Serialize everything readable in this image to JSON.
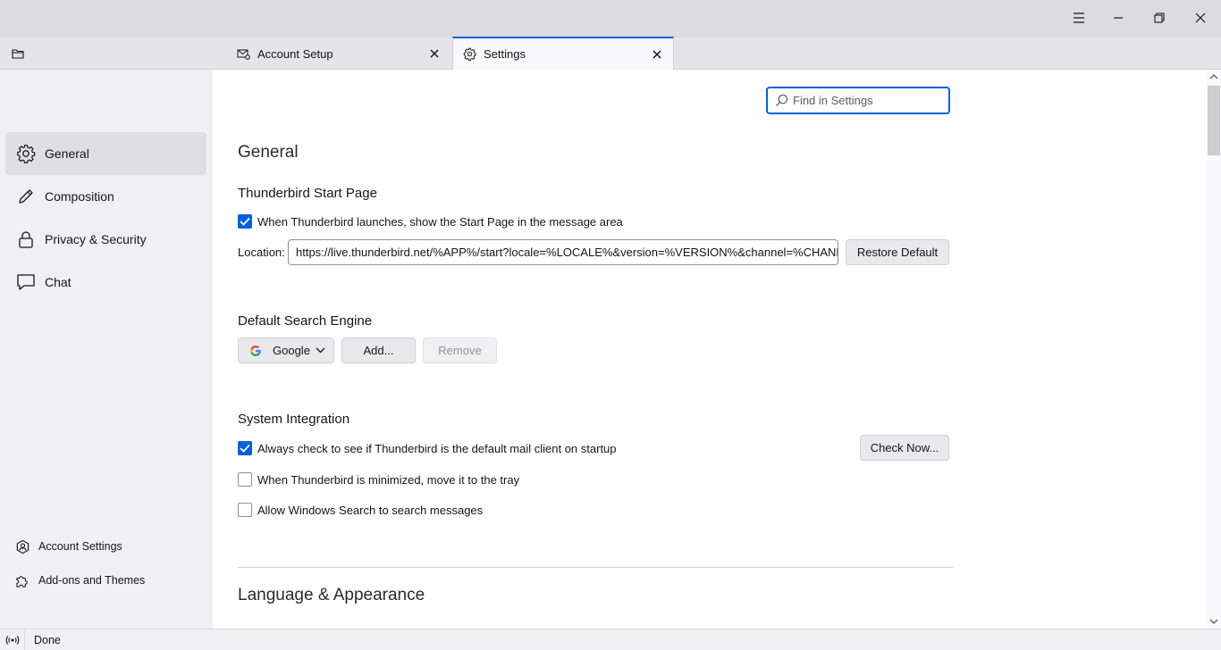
{
  "window": {
    "menu_icon": "hamburger-menu-icon",
    "minimize_icon": "minimize-icon",
    "restore_icon": "restore-icon",
    "close_icon": "close-icon"
  },
  "tabs": [
    {
      "label": "Account Setup",
      "icon": "envelope-gear-icon",
      "active": false
    },
    {
      "label": "Settings",
      "icon": "gear-icon",
      "active": true
    }
  ],
  "sidebar": {
    "items": [
      {
        "label": "General",
        "icon": "gear-icon",
        "selected": true
      },
      {
        "label": "Composition",
        "icon": "pencil-icon",
        "selected": false
      },
      {
        "label": "Privacy & Security",
        "icon": "lock-icon",
        "selected": false
      },
      {
        "label": "Chat",
        "icon": "chat-bubble-icon",
        "selected": false
      }
    ],
    "footer": [
      {
        "label": "Account Settings",
        "icon": "account-icon"
      },
      {
        "label": "Add-ons and Themes",
        "icon": "puzzle-icon"
      }
    ]
  },
  "search": {
    "placeholder": "Find in Settings",
    "value": ""
  },
  "general": {
    "title": "General",
    "start_page": {
      "heading": "Thunderbird Start Page",
      "checkbox_label": "When Thunderbird launches, show the Start Page in the message area",
      "checked": true,
      "location_label": "Location:",
      "location_value": "https://live.thunderbird.net/%APP%/start?locale=%LOCALE%&version=%VERSION%&channel=%CHANNEL%",
      "restore_button": "Restore Default"
    },
    "search_engine": {
      "heading": "Default Search Engine",
      "selected": "Google",
      "add_button": "Add...",
      "remove_button": "Remove"
    },
    "system_integration": {
      "heading": "System Integration",
      "default_client_label": "Always check to see if Thunderbird is the default mail client on startup",
      "default_client_checked": true,
      "check_now_button": "Check Now...",
      "minimize_tray_label": "When Thunderbird is minimized, move it to the tray",
      "minimize_tray_checked": false,
      "windows_search_label": "Allow Windows Search to search messages",
      "windows_search_checked": false
    }
  },
  "language": {
    "title": "Language & Appearance"
  },
  "status": {
    "text": "Done",
    "icon": "online-status-icon"
  }
}
